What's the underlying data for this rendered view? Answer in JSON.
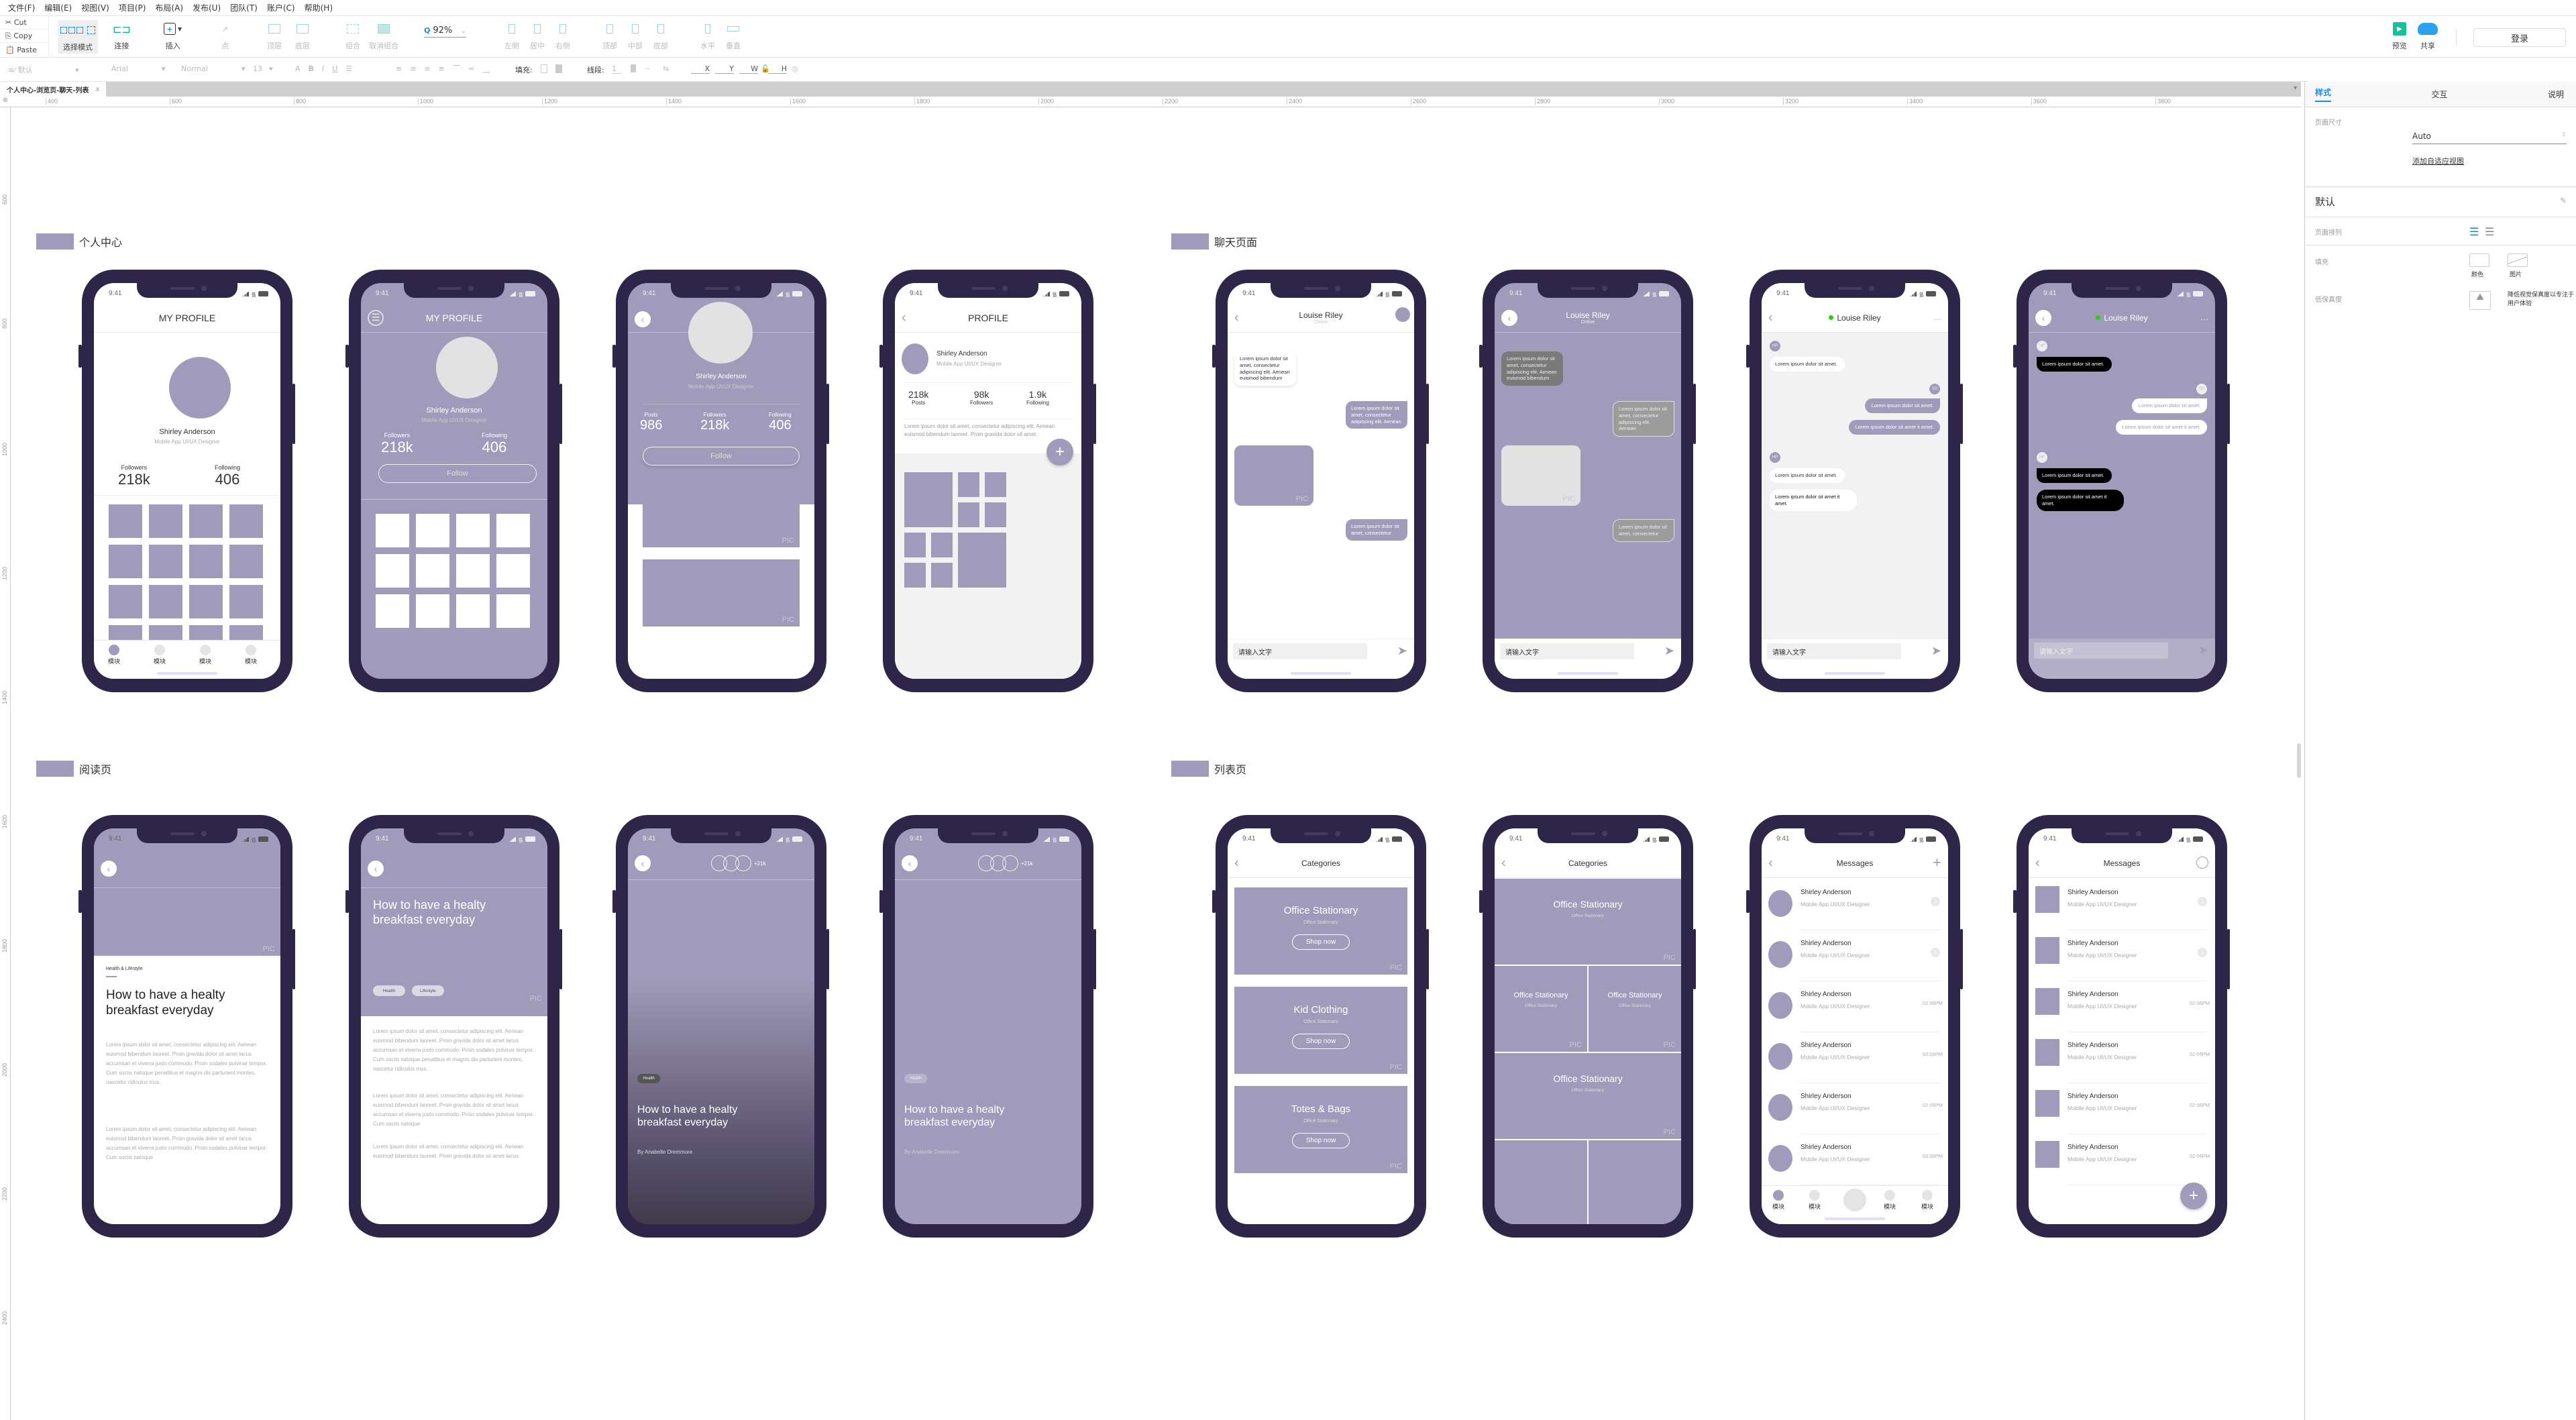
{
  "menu": [
    "文件(F)",
    "编辑(E)",
    "视图(V)",
    "项目(P)",
    "布局(A)",
    "发布(U)",
    "团队(T)",
    "账户(C)",
    "帮助(H)"
  ],
  "clipboard": {
    "cut": "Cut",
    "copy": "Copy",
    "paste": "Paste"
  },
  "toolbar": {
    "select_mode": "选择模式",
    "connect": "连接",
    "insert": "插入",
    "point": "点",
    "top_layer": "顶层",
    "bottom_layer": "底层",
    "group": "组合",
    "ungroup": "取消组合",
    "zoom": "92%",
    "align": [
      "左侧",
      "居中",
      "右侧",
      "顶部",
      "中部",
      "底部",
      "水平",
      "垂直"
    ],
    "preview": "预览",
    "share": "共享",
    "login": "登录"
  },
  "formatbar": {
    "style": "默认",
    "font": "Arial",
    "weight": "Normal",
    "size": "13",
    "fill_label": "填充:",
    "stroke_label": "线段:",
    "stroke_value": "1",
    "x": "X",
    "y": "Y",
    "w": "W",
    "h": "H"
  },
  "doc_tab": {
    "title": "个人中心-浏览页-聊天-列表",
    "close": "x"
  },
  "ruler": {
    "h": [
      "400",
      "600",
      "800",
      "1000",
      "1200",
      "1400",
      "1600",
      "1800",
      "2000",
      "2200",
      "2400",
      "2600",
      "2800",
      "3000",
      "3200",
      "3400",
      "3600",
      "3800"
    ],
    "v": [
      "600",
      "800",
      "1000",
      "1200",
      "1400",
      "1600",
      "1800",
      "2000",
      "2200",
      "2400"
    ]
  },
  "right_panel": {
    "tabs": [
      "样式",
      "交互",
      "说明"
    ],
    "page_size_label": "页面尺寸",
    "page_size_value": "Auto",
    "add_view": "添加自适应视图",
    "section": "默认",
    "page_align_label": "页面排列",
    "fill_label": "填充",
    "fill_color": "颜色",
    "fill_image": "图片",
    "low_fidelity_label": "低保真度",
    "low_fidelity_desc": "降低视觉保真度以专注于用户体验"
  },
  "groups": {
    "profile": "个人中心",
    "chat": "聊天页面",
    "reading": "阅读页",
    "list": "列表页"
  },
  "common": {
    "time": "9:41",
    "pic": "PIC",
    "module": "模块",
    "name": "Shirley Anderson",
    "role": "Mobile App UI/UX Designer",
    "chat_name": "Louise Riley",
    "online": "Online",
    "input_placeholder": "请输入文字",
    "msg_short": "Lorem ipsum dolor sit amet.",
    "msg_long": "Lorem ipsum dolor sit amet it amet.",
    "bubble1": "Lorem ipsum dolor sit amet, consectetur adipiscing elit. Aenean euismod bibendum",
    "bubble2": "Lorem ipsum dolor sit amet, consectetur adipiscing elit. Aenean",
    "bubble3": "Lorem ipsum dolor sit amet, consectetur",
    "hp": "HP",
    "ss": "SS",
    "article_title": "How to have a healty breakfast everyday",
    "category_tag": "Health & Lifestyle",
    "tag_health": "Health",
    "tag_lifestyle": "Lifestyle",
    "author": "By Anabelle Dremmore",
    "readers": "+21k",
    "lorem_para": "Lorem ipsum dolor sit amet, consectetur adipiscing elit. Aenean euismod bibendum laoreet. Proin gravida dolor sit amet lacus accumsan et viverra justo commodo. Proin sodales pulvinar tempor. Cum sociis natoque penatibus et magnis dis parturient montes, nascetur ridiculus mus.",
    "lorem_short": "Lorem ipsum dolor sit amet, consectetur adipiscing elit. Aenean euismod bibendum laoreet. Proin gravida dolor sit amet lacus accumsan et viverra justo commodo. Proin sodales pulvinar tempor. Cum sociis natoque",
    "lorem_bio": "Lorem ipsum dolor sit amet, consectetur adipiscing elit. Aenean euismod bibendum laoreet. Proin gravida dolor sit amet.",
    "follow": "Follow",
    "categories": "Categories",
    "messages": "Messages",
    "shop_now": "Shop now",
    "office": "Office Stationary",
    "kid": "Kid Clothing",
    "totes": "Totes & Bags",
    "time_stamp": "02:06PM",
    "badge": "1"
  },
  "profile1": {
    "title": "MY PROFILE",
    "followers_label": "Followers",
    "followers": "218k",
    "following_label": "Following",
    "following": "406"
  },
  "profile3": {
    "posts_label": "Posts",
    "posts": "986",
    "followers_label": "Followers",
    "followers": "218k",
    "following_label": "Following",
    "following": "406"
  },
  "profile4": {
    "title": "PROFILE",
    "posts": "218k",
    "posts_label": "Posts",
    "followers": "98k",
    "followers_label": "Followers",
    "following": "1.9k",
    "following_label": "Following"
  },
  "colors": {
    "accent": "#a09bba",
    "phone": "#2e2649",
    "link": "#1a8be0",
    "online": "#2ecc1a"
  }
}
